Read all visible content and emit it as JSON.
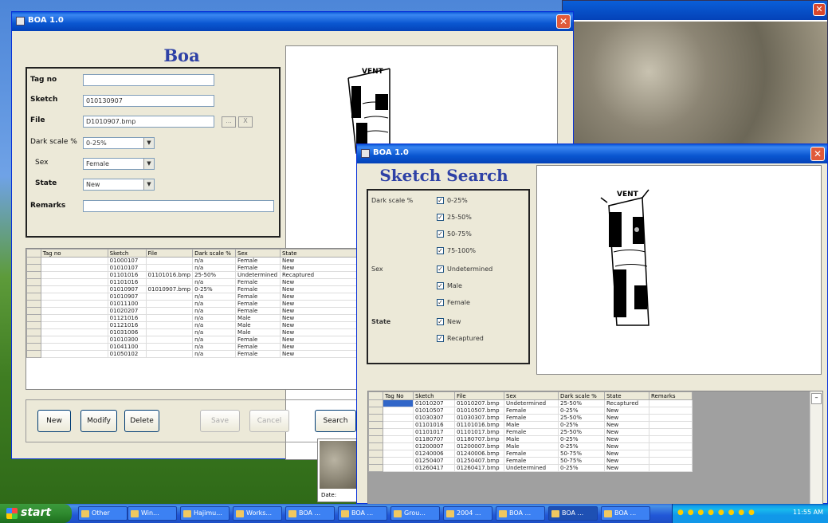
{
  "main_window": {
    "title": "BOA 1.0",
    "heading": "Boa",
    "labels": {
      "tag_no": "Tag no",
      "sketch": "Sketch",
      "file": "File",
      "dark_scale": "Dark scale %",
      "sex": "Sex",
      "state": "State",
      "remarks": "Remarks"
    },
    "values": {
      "tag_no": "",
      "sketch": "010130907",
      "file": "D1010907.bmp",
      "dark_scale": "0-25%",
      "sex": "Female",
      "state": "New",
      "remarks": ""
    },
    "file_browse_label": "...",
    "file_clear_label": "X",
    "grid": {
      "columns": [
        "",
        "Tag no",
        "Sketch",
        "File",
        "Dark scale %",
        "Sex",
        "State"
      ],
      "rows": [
        [
          "",
          "",
          "01000107",
          "",
          "n/a",
          "Female",
          "New"
        ],
        [
          "",
          "",
          "01010107",
          "",
          "n/a",
          "Female",
          "New"
        ],
        [
          "",
          "",
          "01101016",
          "01101016.bmp",
          "25-50%",
          "Undetermined",
          "Recaptured"
        ],
        [
          "",
          "",
          "01101016",
          "",
          "n/a",
          "Female",
          "New"
        ],
        [
          "",
          "",
          "01010907",
          "01010907.bmp",
          "0-25%",
          "Female",
          "New"
        ],
        [
          "",
          "",
          "01010907",
          "",
          "n/a",
          "Female",
          "New"
        ],
        [
          "",
          "",
          "01011100",
          "",
          "n/a",
          "Female",
          "New"
        ],
        [
          "",
          "",
          "01020207",
          "",
          "n/a",
          "Female",
          "New"
        ],
        [
          "",
          "",
          "01121016",
          "",
          "n/a",
          "Male",
          "New"
        ],
        [
          "",
          "",
          "01121016",
          "",
          "n/a",
          "Male",
          "New"
        ],
        [
          "",
          "",
          "01031006",
          "",
          "n/a",
          "Male",
          "New"
        ],
        [
          "",
          "",
          "01010300",
          "",
          "n/a",
          "Female",
          "New"
        ],
        [
          "",
          "",
          "01041100",
          "",
          "n/a",
          "Female",
          "New"
        ],
        [
          "",
          "",
          "01050102",
          "",
          "n/a",
          "Female",
          "New"
        ]
      ]
    },
    "buttons": {
      "new": "New",
      "modify": "Modify",
      "delete": "Delete",
      "save": "Save",
      "cancel": "Cancel",
      "search": "Search"
    }
  },
  "search_window": {
    "title": "BOA 1.0",
    "heading": "Sketch Search",
    "labels": {
      "dark_scale": "Dark scale %",
      "sex": "Sex",
      "state": "State"
    },
    "dark_scale_options": [
      "0-25%",
      "25-50%",
      "50-75%",
      "75-100%"
    ],
    "sex_options": [
      "Undetermined",
      "Male",
      "Female"
    ],
    "state_options": [
      "New",
      "Recaptured"
    ],
    "grid": {
      "columns": [
        "",
        "Tag No",
        "Sketch",
        "File",
        "Sex",
        "Dark scale %",
        "State",
        "Remarks"
      ],
      "rows": [
        [
          "",
          "",
          "01010207",
          "01010207.bmp",
          "Undetermined",
          "25-50%",
          "Recaptured",
          ""
        ],
        [
          "",
          "",
          "01010507",
          "01010507.bmp",
          "Female",
          "0-25%",
          "New",
          ""
        ],
        [
          "",
          "",
          "01030307",
          "01030307.bmp",
          "Female",
          "25-50%",
          "New",
          ""
        ],
        [
          "",
          "",
          "01101016",
          "01101016.bmp",
          "Male",
          "0-25%",
          "New",
          ""
        ],
        [
          "",
          "",
          "01101017",
          "01101017.bmp",
          "Female",
          "25-50%",
          "New",
          ""
        ],
        [
          "",
          "",
          "01180707",
          "01180707.bmp",
          "Male",
          "0-25%",
          "New",
          ""
        ],
        [
          "",
          "",
          "01200007",
          "01200007.bmp",
          "Male",
          "0-25%",
          "New",
          ""
        ],
        [
          "",
          "",
          "01240006",
          "01240006.bmp",
          "Female",
          "50-75%",
          "New",
          ""
        ],
        [
          "",
          "",
          "01250407",
          "01250407.bmp",
          "Female",
          "50-75%",
          "New",
          ""
        ],
        [
          "",
          "",
          "01260417",
          "01260417.bmp",
          "Undetermined",
          "0-25%",
          "New",
          ""
        ]
      ]
    },
    "sketch_label": "VENT"
  },
  "main_sketch_label": "VENT",
  "thumbnail_label": "Date:",
  "taskbar": {
    "start": "start",
    "items": [
      "Other",
      "Win...",
      "Hajimu...",
      "Works...",
      "BOA ...",
      "BOA ...",
      "Grou...",
      "2004 ...",
      "BOA ...",
      "BOA ...",
      "BOA ..."
    ],
    "clock": "11:55 AM"
  },
  "colors": {
    "heading_blue": "#2e41a6",
    "title_bar": "#0a56d0",
    "selection": "#3166c8"
  }
}
